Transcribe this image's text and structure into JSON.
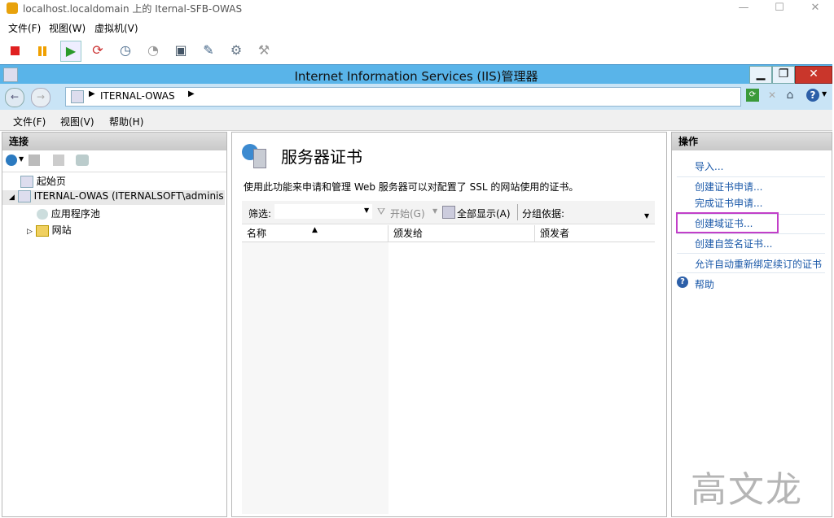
{
  "vm": {
    "title": "localhost.localdomain 上的 Iternal-SFB-OWAS",
    "menu": [
      "文件(F)",
      "视图(W)",
      "虚拟机(V)"
    ]
  },
  "iis": {
    "title": "Internet Information Services (IIS)管理器",
    "address": "ITERNAL-OWAS",
    "menu": [
      "文件(F)",
      "视图(V)",
      "帮助(H)"
    ]
  },
  "left": {
    "header": "连接",
    "tree": {
      "start_page": "起始页",
      "server": "ITERNAL-OWAS (ITERNALSOFT\\adminis",
      "app_pools": "应用程序池",
      "sites": "网站"
    }
  },
  "main": {
    "title": "服务器证书",
    "description": "使用此功能来申请和管理 Web 服务器可以对配置了 SSL 的网站使用的证书。",
    "filter_label": "筛选:",
    "go_label": "开始(G)",
    "show_all_label": "全部显示(A)",
    "group_by_label": "分组依据:",
    "columns": [
      "名称",
      "颁发给",
      "颁发者"
    ]
  },
  "actions": {
    "header": "操作",
    "items": [
      "导入...",
      "创建证书申请...",
      "完成证书申请...",
      "创建域证书...",
      "创建自签名证书...",
      "允许自动重新绑定续订的证书"
    ],
    "help": "帮助",
    "highlight_color": "#c23fc8"
  },
  "watermark": "高文龙"
}
